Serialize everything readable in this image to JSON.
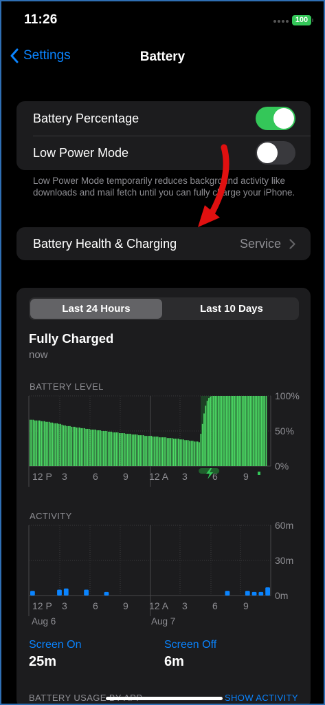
{
  "status_bar": {
    "time": "11:26",
    "battery": "100"
  },
  "nav": {
    "back_label": "Settings",
    "title": "Battery"
  },
  "settings": {
    "battery_percentage": {
      "label": "Battery Percentage",
      "on": true
    },
    "low_power_mode": {
      "label": "Low Power Mode",
      "on": false
    },
    "footnote": "Low Power Mode temporarily reduces background activity like downloads and mail fetch until you can fully charge your iPhone.",
    "battery_health": {
      "label": "Battery Health & Charging",
      "value": "Service"
    }
  },
  "usage": {
    "segments": [
      "Last 24 Hours",
      "Last 10 Days"
    ],
    "selected_segment": "Last 24 Hours",
    "status_title": "Fully Charged",
    "status_sub": "now",
    "battery_level_label": "BATTERY LEVEL",
    "activity_label": "ACTIVITY",
    "screen_on_label": "Screen On",
    "screen_on_value": "25m",
    "screen_off_label": "Screen Off",
    "screen_off_value": "6m",
    "by_app_label": "BATTERY USAGE BY APP",
    "show_activity": "SHOW ACTIVITY"
  },
  "colors": {
    "accent": "#0a84ff",
    "green": "#34c759",
    "bar_green": "#4cd964",
    "charge_bg": "#1f5f2c"
  },
  "chart_data": [
    {
      "type": "bar",
      "title": "BATTERY LEVEL",
      "x_tick_labels": [
        "12 P",
        "3",
        "6",
        "9",
        "12 A",
        "3",
        "6",
        "9"
      ],
      "y_tick_labels": [
        "100%",
        "50%",
        "0%"
      ],
      "ylim": [
        0,
        100
      ],
      "values": [
        66,
        66,
        66,
        65,
        65,
        65,
        65,
        64,
        64,
        64,
        63,
        63,
        63,
        62,
        62,
        61,
        61,
        61,
        60,
        60,
        59,
        58,
        58,
        57,
        57,
        57,
        56,
        56,
        56,
        55,
        55,
        55,
        54,
        54,
        54,
        53,
        53,
        53,
        52,
        52,
        52,
        52,
        51,
        51,
        51,
        50,
        50,
        50,
        50,
        49,
        49,
        49,
        48,
        48,
        48,
        48,
        47,
        47,
        47,
        47,
        46,
        46,
        46,
        46,
        45,
        45,
        45,
        45,
        44,
        44,
        44,
        44,
        43,
        43,
        43,
        43,
        43,
        42,
        42,
        42,
        42,
        41,
        41,
        41,
        41,
        41,
        40,
        40,
        40,
        40,
        39,
        39,
        39,
        39,
        38,
        38,
        38,
        37,
        37,
        37,
        36,
        36,
        36,
        35,
        35,
        35,
        34,
        46,
        60,
        75,
        86,
        93,
        97,
        99,
        100,
        100,
        100,
        100,
        100,
        100,
        100,
        100,
        100,
        100,
        100,
        100,
        100,
        100,
        100,
        100,
        100,
        100,
        100,
        100,
        100,
        100,
        100,
        100,
        100,
        100,
        100,
        100,
        100,
        100,
        100,
        100,
        100,
        100,
        100
      ],
      "charging": true,
      "grid": true
    },
    {
      "type": "bar",
      "title": "ACTIVITY",
      "x_tick_labels": [
        "12 P",
        "3",
        "6",
        "9",
        "12 A",
        "3",
        "6",
        "9"
      ],
      "x_date_labels": [
        "Aug 6",
        "Aug 7"
      ],
      "y_tick_labels": [
        "60m",
        "30m",
        "0m"
      ],
      "ylim": [
        0,
        60
      ],
      "values": [
        4,
        0,
        0,
        0,
        5,
        6,
        0,
        0,
        5,
        0,
        0,
        3,
        0,
        0,
        0,
        0,
        0,
        0,
        0,
        0,
        0,
        0,
        0,
        0,
        0,
        0,
        0,
        0,
        0,
        4,
        0,
        0,
        4,
        3,
        3,
        7
      ],
      "grid": true
    }
  ]
}
